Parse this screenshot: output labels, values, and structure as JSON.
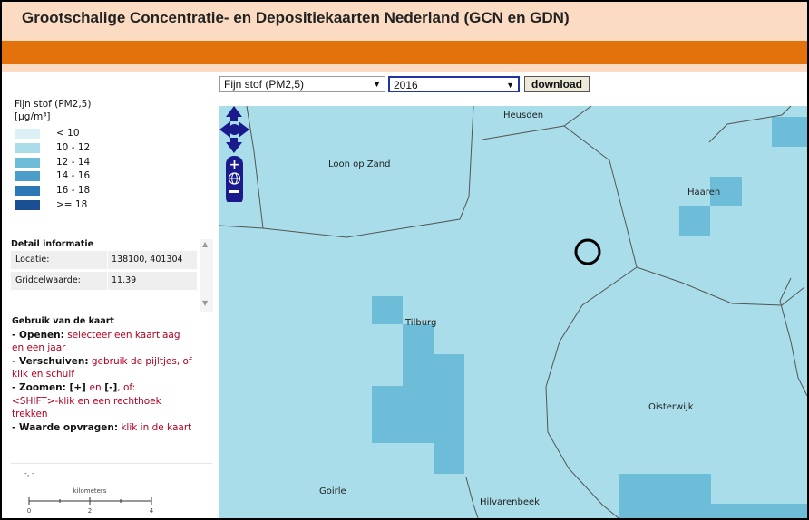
{
  "header": {
    "title": "Grootschalige Concentratie- en Depositiekaarten Nederland (GCN en GDN)"
  },
  "toolbar": {
    "layer_value": "Fijn stof (PM2,5)",
    "year_value": "2016",
    "download_label": "download"
  },
  "legend": {
    "title": "Fijn stof (PM2,5)",
    "unit": "[μg/m³]",
    "classes": [
      {
        "label": "< 10",
        "color": "#dbf1f6"
      },
      {
        "label": "10 - 12",
        "color": "#a8dde9"
      },
      {
        "label": "12 - 14",
        "color": "#6dbcd8"
      },
      {
        "label": "14 - 16",
        "color": "#4a9ec9"
      },
      {
        "label": "16 - 18",
        "color": "#2c78b6"
      },
      {
        "label": ">= 18",
        "color": "#1b4f93"
      }
    ]
  },
  "detail": {
    "header": "Detail informatie",
    "location_label": "Locatie:",
    "location_value": "138100, 401304",
    "grid_label": "Gridcelwaarde:",
    "grid_value": "11.39"
  },
  "usage": {
    "title": "Gebruik van de kaart",
    "open_key": "- Openen:",
    "open_text": " selecteer een kaartlaag",
    "open_text2": "en een jaar",
    "move_key": "- Verschuiven:",
    "move_text": " gebruik de pijltjes, of",
    "move_text2": "klik en schuif",
    "zoom_key": "- Zoomen:",
    "zoom_plus": " [+] ",
    "zoom_en": "en",
    "zoom_minus": " [-]",
    "zoom_of": ", of:",
    "zoom_text2": "<SHIFT>-klik en een rechthoek",
    "zoom_text3": "trekken",
    "value_key": "- Waarde opvragen:",
    "value_text": " klik in de kaart"
  },
  "coord_readout": "-, -",
  "scale": {
    "unit": "kilometers",
    "ticks": [
      "0",
      "2",
      "4"
    ]
  },
  "map": {
    "places": [
      "Heusden",
      "Loon op Zand",
      "Haaren",
      "Tilburg",
      "Oisterwijk",
      "Goirle",
      "Hilvarenbeek"
    ],
    "base_color": "#a8dde9",
    "cell_color": "#6dbcd8",
    "boundary_color": "#555555"
  }
}
